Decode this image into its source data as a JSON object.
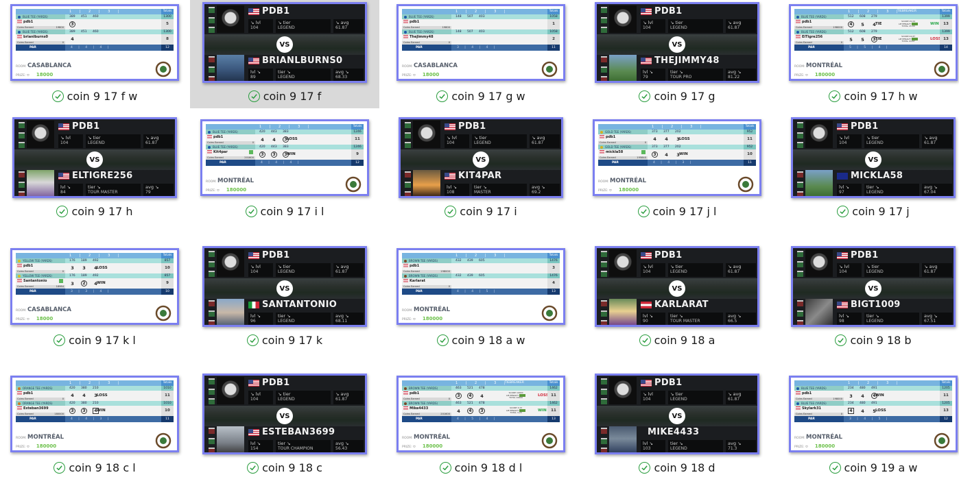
{
  "view": "file-explorer-large-icons",
  "accent_border": "#7b7ff0",
  "sync_status_icon": "check-circle-icon",
  "files": [
    {
      "name": "coin 9 17 f w",
      "type": "scorecard",
      "room": "CASABLANCA",
      "prize": "18000",
      "tee": "BLUE TEE (YARDS)",
      "tee_color": "#1e5aa8",
      "holes": [
        "1",
        "2",
        "3"
      ],
      "yards": [
        "389",
        "451",
        "460"
      ],
      "yards_total": "1300",
      "p1": {
        "name": "pdb1",
        "scores": [
          "3",
          "",
          ""
        ],
        "circled": [
          true,
          false,
          false
        ],
        "result": "",
        "total": "5",
        "coins": "19800"
      },
      "p2": {
        "name": "brianlburns0",
        "scores": [
          "4",
          "",
          ""
        ],
        "circled": [
          false,
          false,
          false
        ],
        "result": "",
        "total": "8",
        "coins": "0"
      },
      "par": [
        "4",
        "4",
        "4"
      ],
      "par_total": "12",
      "logo": "shield-logo"
    },
    {
      "name": "coin 9 17 f",
      "type": "vs",
      "selected": true,
      "p1": {
        "name": "PDB1",
        "flag": "us",
        "lvl": "104",
        "tier": "LEGEND",
        "avg": "61.87"
      },
      "p2": {
        "name": "BRIANLBURNS0",
        "flag": "us",
        "lvl": "89",
        "tier": "LEGEND",
        "avg": "68.33",
        "avatar": "photo1"
      }
    },
    {
      "name": "coin 9 17 g w",
      "type": "scorecard",
      "room": "CASABLANCA",
      "prize": "18000",
      "tee": "BLUE TEE (YARDS)",
      "tee_color": "#1e5aa8",
      "holes": [
        "1",
        "2",
        "3"
      ],
      "yards": [
        "148",
        "507",
        "403"
      ],
      "yards_total": "1058",
      "p1": {
        "name": "pdb1",
        "scores": [
          "",
          "",
          ""
        ],
        "circled": [
          false,
          false,
          false
        ],
        "result": "",
        "total": "1",
        "coins": "19800"
      },
      "p2": {
        "name": "TheJimmy48",
        "scores": [
          "",
          "",
          ""
        ],
        "circled": [
          false,
          false,
          false
        ],
        "result": "",
        "total": "2",
        "coins": "0"
      },
      "par": [
        "3",
        "4",
        "4"
      ],
      "par_total": "11",
      "logo": "erin-hills-logo"
    },
    {
      "name": "coin 9 17 g",
      "type": "vs",
      "p1": {
        "name": "PDB1",
        "flag": "us",
        "lvl": "104",
        "tier": "LEGEND",
        "avg": "61.87"
      },
      "p2": {
        "name": "THEJIMMY48",
        "flag": "us",
        "lvl": "79",
        "tier": "TOUR PRO",
        "avg": "81.22",
        "avatar": "photo4"
      }
    },
    {
      "name": "coin 9 17 h w",
      "type": "scorecard",
      "room": "MONTRÉAL",
      "prize": "180000",
      "tiebreaker": "TIEBREAKER",
      "tee": "BLUE TEE (YARDS)",
      "tee_color": "#1e5aa8",
      "holes": [
        "1",
        "2",
        "3"
      ],
      "yards": [
        "512",
        "608",
        "279"
      ],
      "yards_total": "1399",
      "p1": {
        "name": "pdb1",
        "scores": [
          "4",
          "5",
          "4"
        ],
        "circled": [
          true,
          false,
          false
        ],
        "result": "TIE",
        "tb_result": "WIN",
        "total": "13",
        "coins": "198000",
        "tb_score": "SCORE 15.04",
        "tb_total": "TOTAL 15.04"
      },
      "p2": {
        "name": "ElTigre256",
        "scores": [
          "5",
          "5",
          "3"
        ],
        "circled": [
          false,
          false,
          true
        ],
        "result": "TIE",
        "tb_result": "LOSS",
        "total": "13",
        "coins": "0",
        "tb_score": "SCORE 24.87",
        "tb_total": "TOTAL 24.87"
      },
      "par": [
        "5",
        "5",
        "4"
      ],
      "par_total": "14",
      "logo": "cc-logo"
    },
    {
      "name": "coin 9 17 h",
      "type": "vs",
      "p1": {
        "name": "PDB1",
        "flag": "us",
        "lvl": "104",
        "tier": "LEGEND",
        "avg": "61.87"
      },
      "p2": {
        "name": "ELTIGRE256",
        "flag": "us",
        "lvl": "84",
        "tier": "TOUR MASTER",
        "avg": "79",
        "avatar": "photo2"
      }
    },
    {
      "name": "coin 9 17 i l",
      "type": "scorecard",
      "room": "MONTRÉAL",
      "prize": "180000",
      "tee": "BLUE TEE (YARDS)",
      "tee_color": "#1e5aa8",
      "holes": [
        "1",
        "2",
        "3"
      ],
      "yards": [
        "420",
        "443",
        "383"
      ],
      "yards_total": "1246",
      "p1": {
        "name": "pdb1",
        "scores": [
          "4",
          "4",
          "3"
        ],
        "circled": [
          false,
          false,
          true
        ],
        "result": "LOSS",
        "total": "11",
        "coins": "0"
      },
      "p2": {
        "name": "Kit4par",
        "scores": [
          "3",
          "3",
          "3"
        ],
        "circled": [
          true,
          true,
          true
        ],
        "result": "WIN",
        "total": "9",
        "coins": "201600",
        "plus": true
      },
      "par": [
        "4",
        "4",
        "4"
      ],
      "par_total": "12",
      "logo": "wolf-creek-logo"
    },
    {
      "name": "coin 9 17 i",
      "type": "vs",
      "p1": {
        "name": "PDB1",
        "flag": "us",
        "lvl": "104",
        "tier": "LEGEND",
        "avg": "61.87"
      },
      "p2": {
        "name": "KIT4PAR",
        "flag": "us",
        "lvl": "108",
        "tier": "MASTER",
        "avg": "69.2",
        "avatar": "photo3"
      }
    },
    {
      "name": "coin 9 17 j l",
      "type": "scorecard",
      "room": "MONTRÉAL",
      "prize": "180000",
      "tee": "GOLD TEE (YARDS)",
      "tee_color": "#d4b020",
      "holes": [
        "1",
        "2",
        "3"
      ],
      "yards": [
        "373",
        "377",
        "202"
      ],
      "yards_total": "952",
      "p1": {
        "name": "pdb1",
        "scores": [
          "4",
          "4",
          "3"
        ],
        "circled": [
          false,
          false,
          false
        ],
        "result": "LOSS",
        "total": "11",
        "coins": "0"
      },
      "p2": {
        "name": "mickla58",
        "scores": [
          "3",
          "4",
          "3"
        ],
        "circled": [
          true,
          false,
          false
        ],
        "result": "WIN",
        "total": "10",
        "coins": "195840",
        "plus": true
      },
      "par": [
        "4",
        "4",
        "3"
      ],
      "par_total": "11",
      "logo": "urban-course-logo"
    },
    {
      "name": "coin 9 17 j",
      "type": "vs",
      "p1": {
        "name": "PDB1",
        "flag": "us",
        "lvl": "104",
        "tier": "LEGEND",
        "avg": "61.87"
      },
      "p2": {
        "name": "MICKLA58",
        "flag": "au",
        "lvl": "97",
        "tier": "LEGEND",
        "avg": "67.04",
        "avatar": "photo4"
      }
    },
    {
      "name": "coin 9 17 k l",
      "type": "scorecard",
      "room": "CASABLANCA",
      "prize": "18000",
      "tee": "YELLOW TEE (YARDS)",
      "tee_color": "#d8c020",
      "holes": [
        "1",
        "2",
        "3"
      ],
      "yards": [
        "176",
        "189",
        "492"
      ],
      "yards_total": "857",
      "p1": {
        "name": "pdb1",
        "scores": [
          "3",
          "3",
          "4"
        ],
        "circled": [
          false,
          false,
          false
        ],
        "result": "LOSS",
        "total": "10",
        "coins": "0"
      },
      "p2": {
        "name": "Santantonio",
        "scores": [
          "3",
          "2",
          "4"
        ],
        "circled": [
          false,
          true,
          false
        ],
        "result": "WIN",
        "total": "9",
        "coins": "18984",
        "plus": true
      },
      "par": [
        "3",
        "3",
        "4"
      ],
      "par_total": "10",
      "logo": "chambers-bay-logo"
    },
    {
      "name": "coin 9 17 k",
      "type": "vs",
      "p1": {
        "name": "PDB1",
        "flag": "us",
        "lvl": "104",
        "tier": "LEGEND",
        "avg": "61.87"
      },
      "p2": {
        "name": "SANTANTONIO",
        "flag": "it",
        "lvl": "96",
        "tier": "LEGEND",
        "avg": "68.11",
        "avatar": "photo5"
      }
    },
    {
      "name": "coin 9 18 a w",
      "type": "scorecard",
      "room": "MONTRÉAL",
      "prize": "180000",
      "tee": "BROWN TEE (YARDS)",
      "tee_color": "#7a4a2a",
      "holes": [
        "1",
        "2",
        "3"
      ],
      "yards": [
        "432",
        "439",
        "605"
      ],
      "yards_total": "1476",
      "p1": {
        "name": "pdb1",
        "scores": [
          "",
          "",
          ""
        ],
        "circled": [
          false,
          false,
          false
        ],
        "result": "",
        "total": "3",
        "coins": "198000"
      },
      "p2": {
        "name": "Karlarat",
        "scores": [
          "",
          "",
          ""
        ],
        "circled": [
          false,
          false,
          false
        ],
        "result": "",
        "total": "4",
        "coins": "0"
      },
      "par": [
        "4",
        "4",
        "5"
      ],
      "par_total": "13",
      "logo": "torrey-pines-logo"
    },
    {
      "name": "coin 9 18 a",
      "type": "vs",
      "p1": {
        "name": "PDB1",
        "flag": "us",
        "lvl": "104",
        "tier": "LEGEND",
        "avg": "61.87"
      },
      "p2": {
        "name": "KARLARAT",
        "flag": "at",
        "lvl": "90",
        "tier": "TOUR MASTER",
        "avg": "66.5",
        "avatar": "photo6"
      }
    },
    {
      "name": "coin 9 18 b",
      "type": "vs",
      "p1": {
        "name": "PDB1",
        "flag": "us",
        "lvl": "104",
        "tier": "LEGEND",
        "avg": "61.87"
      },
      "p2": {
        "name": "BIGT1009",
        "flag": "us",
        "lvl": "98",
        "tier": "LEGEND",
        "avg": "67.51",
        "avatar": "photo7"
      }
    },
    {
      "name": "coin 9 18 c l",
      "type": "scorecard",
      "room": "MONTRÉAL",
      "prize": "180000",
      "tee": "ORANGE TEE (YARDS)",
      "tee_color": "#d07a20",
      "holes": [
        "1",
        "2",
        "3"
      ],
      "yards": [
        "420",
        "380",
        "210"
      ],
      "yards_total": "1010",
      "p1": {
        "name": "pdb1",
        "scores": [
          "4",
          "4",
          "3"
        ],
        "circled": [
          false,
          false,
          false
        ],
        "result": "LOSS",
        "total": "11",
        "coins": "0"
      },
      "p2": {
        "name": "Esteban3699",
        "scores": [
          "3",
          "3",
          "4"
        ],
        "circled": [
          true,
          true,
          false
        ],
        "boxed": [
          false,
          false,
          true
        ],
        "result": "WIN",
        "total": "10",
        "coins": "180000"
      },
      "par": [
        "4",
        "4",
        "3"
      ],
      "par_total": "11",
      "logo": "augusta-tree-logo"
    },
    {
      "name": "coin 9 18 c",
      "type": "vs",
      "p1": {
        "name": "PDB1",
        "flag": "us",
        "lvl": "104",
        "tier": "LEGEND",
        "avg": "61.87"
      },
      "p2": {
        "name": "ESTEBAN3699",
        "flag": "us",
        "lvl": "154",
        "tier": "TOUR CHAMPION",
        "avg": "56.43",
        "avatar": "photo8"
      }
    },
    {
      "name": "coin 9 18 d l",
      "type": "scorecard",
      "room": "MONTRÉAL",
      "prize": "180000",
      "tiebreaker": "TIEBREAKER",
      "tee": "BROWN TEE (YARDS)",
      "tee_color": "#7a4a2a",
      "holes": [
        "1",
        "2",
        "3"
      ],
      "yards": [
        "463",
        "521",
        "478"
      ],
      "yards_total": "1462",
      "p1": {
        "name": "pdb1",
        "scores": [
          "3",
          "4",
          "4"
        ],
        "circled": [
          true,
          true,
          false
        ],
        "result": "",
        "tb_result": "LOSS",
        "total": "11",
        "coins": "0",
        "tb_score": "SCORE 10000",
        "tb_total": "TOTAL 10000"
      },
      "p2": {
        "name": "Mike4433",
        "scores": [
          "4",
          "4",
          "3"
        ],
        "circled": [
          false,
          true,
          true
        ],
        "result": "",
        "tb_result": "WIN",
        "total": "11",
        "coins": "201600",
        "tb_score": "SCORE 3.23",
        "tb_total": "TOTAL 3.23"
      },
      "par": [
        "4",
        "5",
        "4"
      ],
      "par_total": "13",
      "logo": "torrey-pines-logo"
    },
    {
      "name": "coin 9 18 d",
      "type": "vs",
      "p1": {
        "name": "PDB1",
        "flag": "us",
        "lvl": "104",
        "tier": "LEGEND",
        "avg": "61.87"
      },
      "p2": {
        "name": "MIKE4433",
        "flag": "none",
        "lvl": "103",
        "tier": "LEGEND",
        "avg": "71.3",
        "avatar": "photo9"
      }
    },
    {
      "name": "coin 9 19 a w",
      "type": "scorecard",
      "room": "MONTRÉAL",
      "prize": "180000",
      "tee": "BLUE TEE (YARDS)",
      "tee_color": "#1e5aa8",
      "holes": [
        "1",
        "2",
        "3"
      ],
      "yards": [
        "234",
        "480",
        "491"
      ],
      "yards_total": "1205",
      "p1": {
        "name": "pdb1",
        "scores": [
          "3",
          "4",
          "4"
        ],
        "circled": [
          false,
          false,
          true
        ],
        "result": "WIN",
        "total": "11",
        "coins": "198000"
      },
      "p2": {
        "name": "Skylark31",
        "scores": [
          "4",
          "4",
          "5"
        ],
        "circled": [
          false,
          false,
          false
        ],
        "boxed": [
          true,
          false,
          false
        ],
        "result": "LOSS",
        "total": "13",
        "coins": "0"
      },
      "par": [
        "3",
        "4",
        "5"
      ],
      "par_total": "12",
      "logo": "wings-logo"
    }
  ],
  "labels": {
    "vs": "VS",
    "lvl": "lvl",
    "tier": "tier",
    "avg": "avg",
    "room": "ROOM:",
    "prize": "PRIZE:",
    "coins_earned": "Coins Earned",
    "par": "PAR",
    "totals": "Totals",
    "lie_penalty": "LIE PENALTY"
  }
}
